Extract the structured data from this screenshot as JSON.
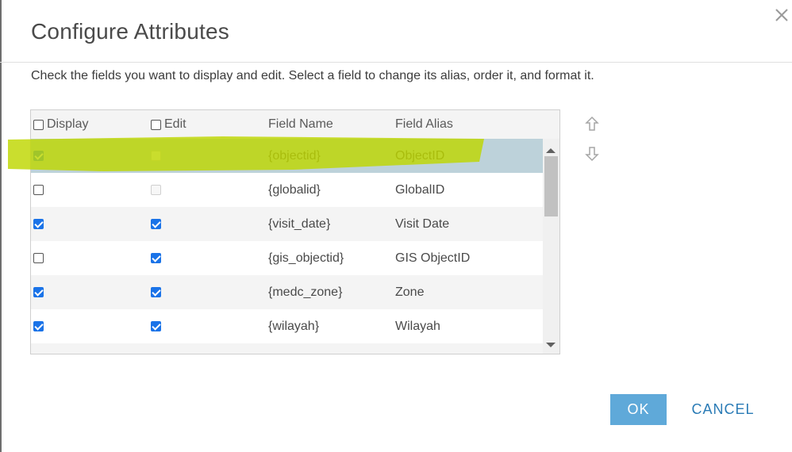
{
  "dialog": {
    "title": "Configure Attributes",
    "description": "Check the fields you want to display and edit. Select a field to change its alias, order it, and format it."
  },
  "table": {
    "headers": {
      "display": "Display",
      "edit": "Edit",
      "field_name": "Field Name",
      "field_alias": "Field Alias"
    },
    "rows": [
      {
        "display": true,
        "edit": false,
        "edit_disabled": true,
        "field_name": "{objectid}",
        "field_alias": "ObjectID",
        "selected": true
      },
      {
        "display": false,
        "edit": false,
        "edit_disabled": true,
        "field_name": "{globalid}",
        "field_alias": "GlobalID",
        "selected": false
      },
      {
        "display": true,
        "edit": true,
        "edit_disabled": false,
        "field_name": "{visit_date}",
        "field_alias": "Visit Date",
        "selected": false
      },
      {
        "display": false,
        "edit": true,
        "edit_disabled": false,
        "field_name": "{gis_objectid}",
        "field_alias": "GIS ObjectID",
        "selected": false
      },
      {
        "display": true,
        "edit": true,
        "edit_disabled": false,
        "field_name": "{medc_zone}",
        "field_alias": "Zone",
        "selected": false
      },
      {
        "display": true,
        "edit": true,
        "edit_disabled": false,
        "field_name": "{wilayah}",
        "field_alias": "Wilayah",
        "selected": false
      },
      {
        "display": true,
        "edit": true,
        "edit_disabled": false,
        "field_name": "",
        "field_alias": "",
        "selected": false
      }
    ]
  },
  "buttons": {
    "ok": "OK",
    "cancel": "CANCEL"
  },
  "icons": {
    "close": "close-icon",
    "move_up": "arrow-up-icon",
    "move_down": "arrow-down-icon"
  },
  "colors": {
    "ok_button": "#5fa9d9",
    "cancel_text": "#2a7bb6",
    "checkbox_checked": "#1a73e8",
    "selected_row": "#bdd2da",
    "highlight_marker": "#bed700"
  }
}
